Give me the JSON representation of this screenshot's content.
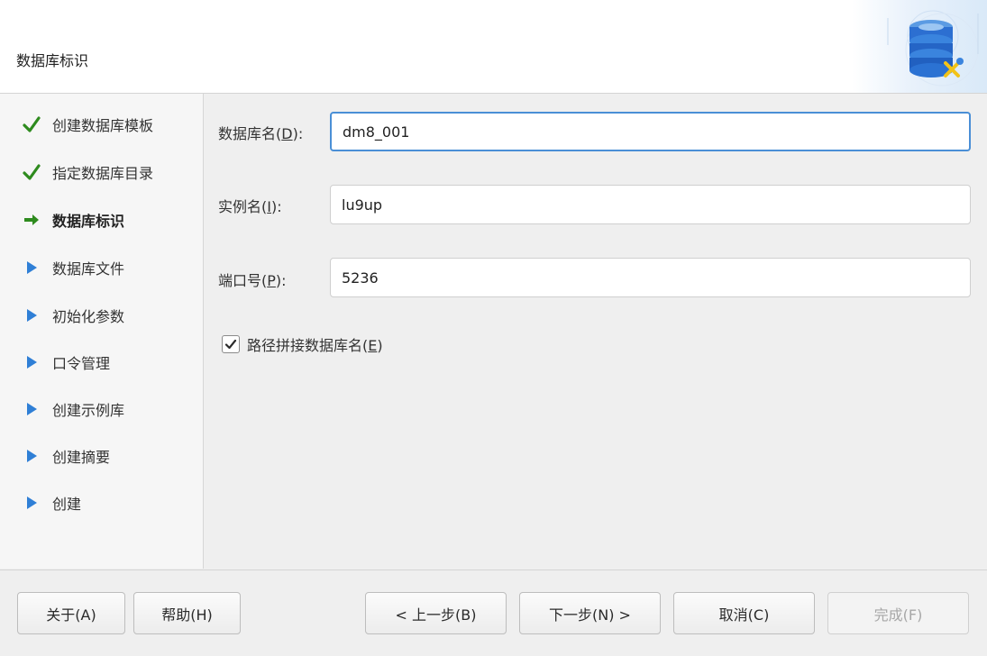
{
  "header": {
    "title": "数据库标识",
    "art_icon": "database-tools-icon"
  },
  "steps": [
    {
      "label": "创建数据库模板",
      "state": "done",
      "icon": "check-icon"
    },
    {
      "label": "指定数据库目录",
      "state": "done",
      "icon": "check-icon"
    },
    {
      "label": "数据库标识",
      "state": "current",
      "icon": "arrow-right-icon"
    },
    {
      "label": "数据库文件",
      "state": "pending",
      "icon": "triangle-right-icon"
    },
    {
      "label": "初始化参数",
      "state": "pending",
      "icon": "triangle-right-icon"
    },
    {
      "label": "口令管理",
      "state": "pending",
      "icon": "triangle-right-icon"
    },
    {
      "label": "创建示例库",
      "state": "pending",
      "icon": "triangle-right-icon"
    },
    {
      "label": "创建摘要",
      "state": "pending",
      "icon": "triangle-right-icon"
    },
    {
      "label": "创建",
      "state": "pending",
      "icon": "triangle-right-icon"
    }
  ],
  "form": {
    "db_name": {
      "label_pre": "数据库名(",
      "mnemonic": "D",
      "label_post": "):",
      "value": "dm8_001"
    },
    "instance_name": {
      "label_pre": "实例名(",
      "mnemonic": "I",
      "label_post": "):",
      "value": "lu9up"
    },
    "port": {
      "label_pre": "端口号(",
      "mnemonic": "P",
      "label_post": "):",
      "value": "5236"
    },
    "append_path": {
      "label_pre": "路径拼接数据库名(",
      "mnemonic": "E",
      "label_post": ")",
      "checked": true
    }
  },
  "footer": {
    "about": "关于(A)",
    "help": "帮助(H)",
    "back": "< 上一步(B)",
    "next": "下一步(N) >",
    "cancel": "取消(C)",
    "finish": "完成(F)"
  },
  "colors": {
    "check": "#2e8b1e",
    "arrow": "#2e8b1e",
    "triangle": "#2f7fd6",
    "focus": "#4a8fd6"
  }
}
